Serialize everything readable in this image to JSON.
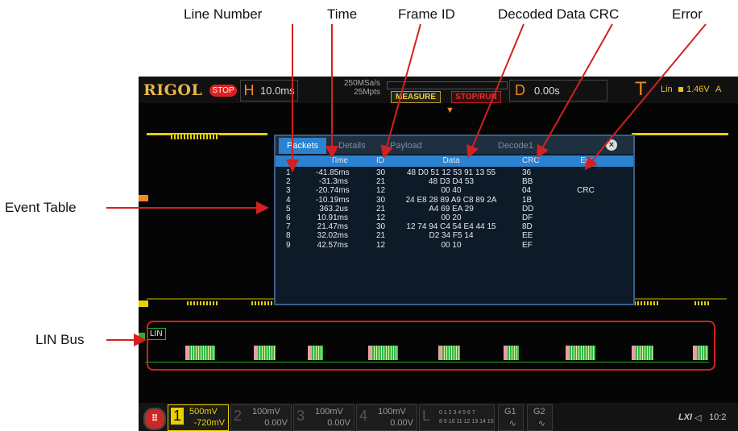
{
  "annotations": {
    "line_number": "Line Number",
    "time": "Time",
    "frame_id": "Frame ID",
    "decoded_data_crc": "Decoded Data CRC",
    "error": "Error",
    "event_table": "Event  Table",
    "lin_bus": "LIN Bus"
  },
  "scope": {
    "logo": "RIGOL",
    "run_state": "STOP",
    "horizontal": {
      "key": "H",
      "value": "10.0ms"
    },
    "sample_rate": "250MSa/s",
    "memory_depth": "25Mpts",
    "measure_label": "MEASURE",
    "stoprun_label": "STOP/RUN",
    "delay": {
      "key": "D",
      "value": "0.00s"
    },
    "trigger": {
      "key": "T",
      "mode": "Lin",
      "level": "1.46V",
      "extra": "A"
    },
    "bus_label": "LIN",
    "lxi": "LXI",
    "time_fragment": "10:2"
  },
  "event_table": {
    "tabs": [
      "Packets",
      "Details",
      "Payload",
      "Decode1"
    ],
    "active_tab": "Packets",
    "close_icon": "x-icon",
    "headers": {
      "line": "",
      "time": "Time",
      "id": "ID",
      "data": "Data",
      "crc": "CRC",
      "err": "Err"
    },
    "rows": [
      {
        "line": "1",
        "time": "-41.85ms",
        "id": "30",
        "data": "48 D0 51 12 53 91 13 55",
        "crc": "36",
        "err": ""
      },
      {
        "line": "2",
        "time": "-31.3ms",
        "id": "21",
        "data": "48 D3 D4 53",
        "crc": "BB",
        "err": ""
      },
      {
        "line": "3",
        "time": "-20.74ms",
        "id": "12",
        "data": "00 40",
        "crc": "04",
        "err": "CRC"
      },
      {
        "line": "4",
        "time": "-10.19ms",
        "id": "30",
        "data": "24 E8 28 89 A9 C8 89 2A",
        "crc": "1B",
        "err": ""
      },
      {
        "line": "5",
        "time": "363.2us",
        "id": "21",
        "data": "A4 69 EA 29",
        "crc": "DD",
        "err": ""
      },
      {
        "line": "6",
        "time": "10.91ms",
        "id": "12",
        "data": "00 20",
        "crc": "DF",
        "err": ""
      },
      {
        "line": "7",
        "time": "21.47ms",
        "id": "30",
        "data": "12 74 94 C4 54 E4 44 15",
        "crc": "8D",
        "err": ""
      },
      {
        "line": "8",
        "time": "32.02ms",
        "id": "21",
        "data": "D2 34 F5 14",
        "crc": "EE",
        "err": ""
      },
      {
        "line": "9",
        "time": "42.57ms",
        "id": "12",
        "data": "00 10",
        "crc": "EF",
        "err": ""
      }
    ]
  },
  "channels": [
    {
      "num": "1",
      "scale": "500mV",
      "offset": "-720mV"
    },
    {
      "num": "2",
      "scale": "100mV",
      "offset": "0.00V"
    },
    {
      "num": "3",
      "scale": "100mV",
      "offset": "0.00V"
    },
    {
      "num": "4",
      "scale": "100mV",
      "offset": "0.00V"
    }
  ],
  "logic": {
    "key": "L",
    "bits_top": "0 1 2 3  4 5 6 7",
    "bits_bottom": "8 9 10 11 12 13 14 15"
  },
  "generators": [
    "G1",
    "G2"
  ],
  "colors": {
    "ch1": "#e8d000",
    "lin": "#39b54a",
    "table_header": "#2a82d0",
    "annotation_red": "#d32020",
    "brand": "#e8b84a"
  }
}
